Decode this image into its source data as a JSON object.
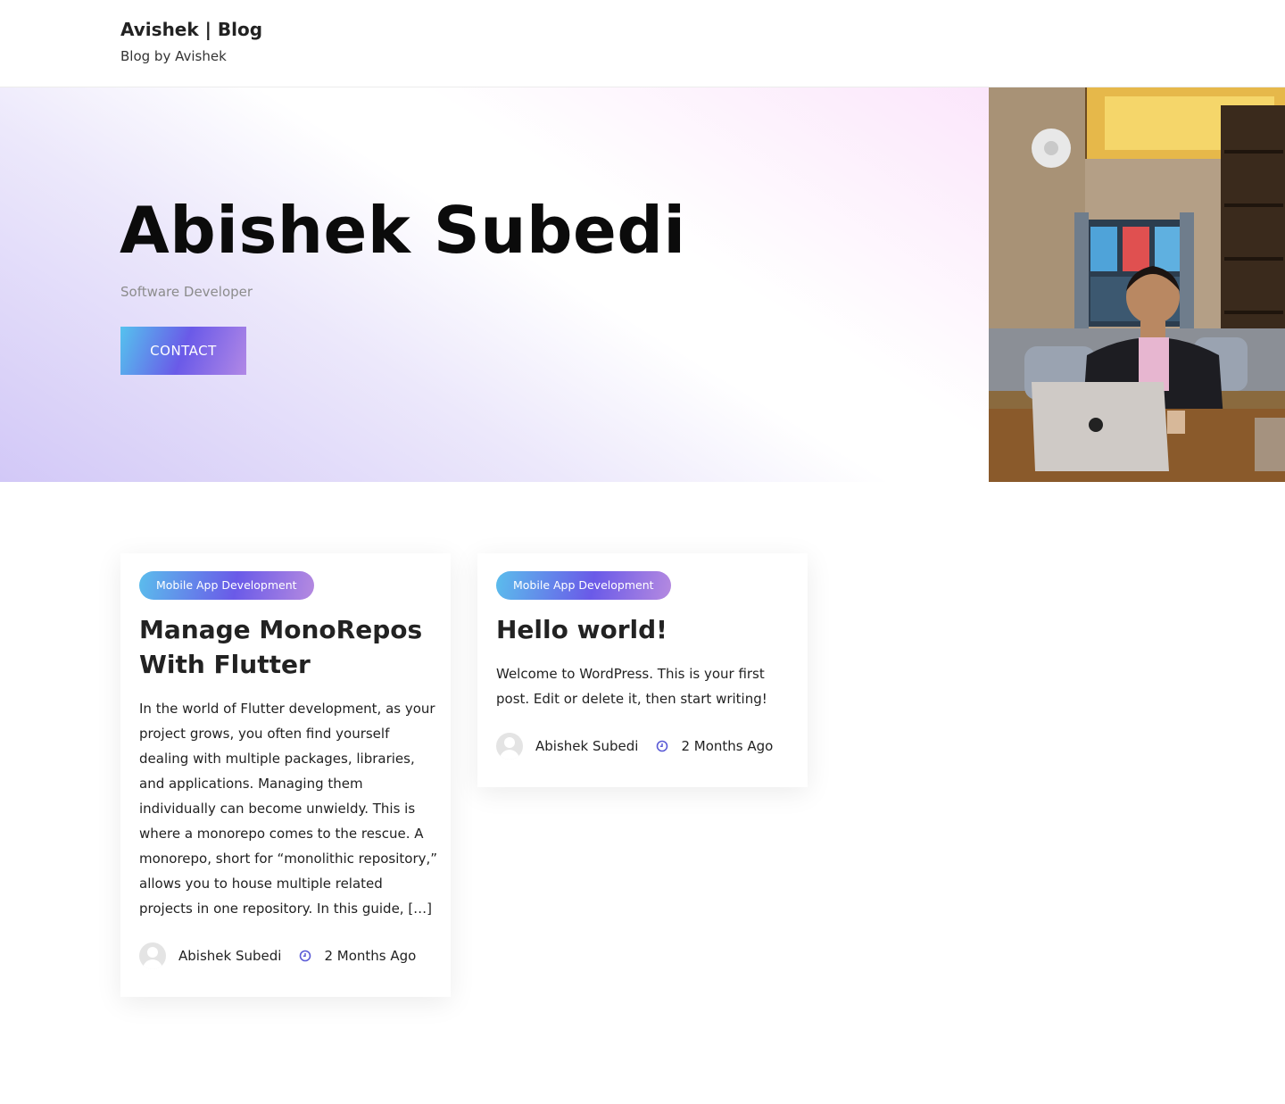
{
  "header": {
    "site_title": "Avishek | Blog",
    "tagline": "Blog by Avishek"
  },
  "hero": {
    "name": "Abishek Subedi",
    "role": "Software Developer",
    "contact_label": "CONTACT"
  },
  "posts": [
    {
      "category": "Mobile App Development",
      "title": "Manage MonoRepos With Flutter",
      "excerpt": "In the world of Flutter development, as your project grows, you often find yourself dealing with multiple packages, libraries, and applications. Managing them individually can become unwieldy. This is where a monorepo comes to the rescue. A monorepo, short for “monolithic repository,” allows you to house multiple related projects in one repository. In this guide, […]",
      "author": "Abishek Subedi",
      "date": "2 Months Ago"
    },
    {
      "category": "Mobile App Development",
      "title": "Hello world!",
      "excerpt": "Welcome to WordPress. This is your first post. Edit or delete it, then start writing!",
      "author": "Abishek Subedi",
      "date": "2 Months Ago"
    }
  ],
  "colors": {
    "accent_blue": "#55c2ee",
    "accent_purple": "#6a5ae8",
    "accent_violet": "#b188e6",
    "clock_icon": "#5b5bd6"
  }
}
